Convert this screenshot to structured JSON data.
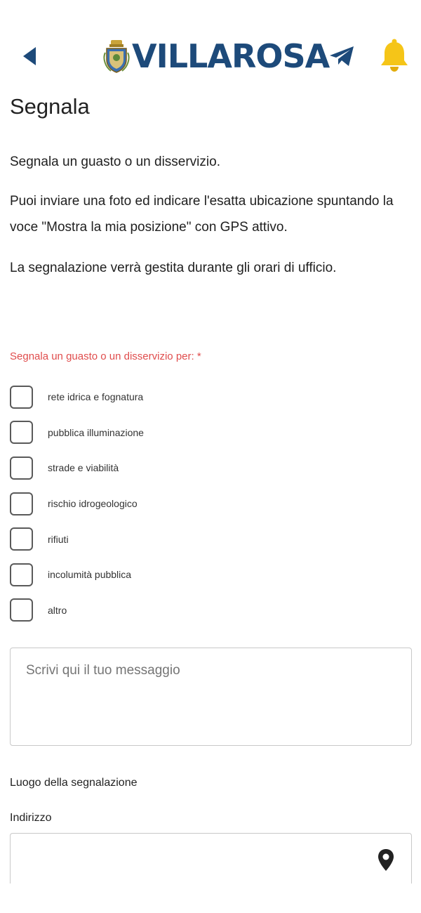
{
  "header": {
    "logo_text": "VILLAROSA",
    "icons": {
      "back": "back-arrow-icon",
      "crest": "coat-of-arms-icon",
      "telegram": "telegram-icon",
      "bell": "bell-icon"
    },
    "colors": {
      "brand": "#1d4a7a",
      "bell": "#f5c518"
    }
  },
  "page": {
    "title": "Segnala",
    "intro_1": "Segnala un guasto o un disservizio.",
    "intro_2": "Puoi inviare una foto ed indicare l'esatta ubicazione spuntando la voce \"Mostra la mia posizione\" con GPS attivo.",
    "intro_3": "La segnalazione verrà gestita durante gli orari di ufficio."
  },
  "form": {
    "category_label": "Segnala un guasto o un disservizio per: *",
    "label_color": "#e04d4d",
    "options": [
      {
        "label": "rete idrica e fognatura",
        "checked": false
      },
      {
        "label": "pubblica illuminazione",
        "checked": false
      },
      {
        "label": "strade e viabilità",
        "checked": false
      },
      {
        "label": "rischio idrogeologico",
        "checked": false
      },
      {
        "label": "rifiuti",
        "checked": false
      },
      {
        "label": "incolumità pubblica",
        "checked": false
      },
      {
        "label": "altro",
        "checked": false
      }
    ],
    "message_placeholder": "Scrivi qui il tuo messaggio",
    "message_value": "",
    "location_label": "Luogo della segnalazione",
    "address_label": "Indirizzo",
    "address_value": "",
    "address_icon": "map-pin-icon"
  }
}
